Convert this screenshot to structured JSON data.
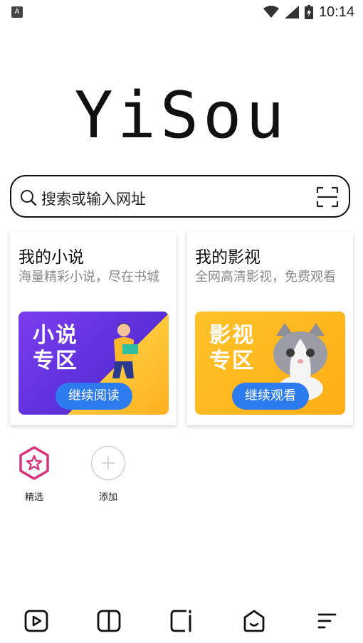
{
  "status_bar": {
    "left_badge": "A",
    "time": "10:14"
  },
  "logo": "YiSou",
  "search": {
    "placeholder": "搜索或输入网址"
  },
  "cards": [
    {
      "title": "我的小说",
      "desc": "海量精彩小说，尽在书城",
      "banner_text_line1": "小说",
      "banner_text_line2": "专区",
      "button": "继续阅读"
    },
    {
      "title": "我的影视",
      "desc": "全网高清影视，免费观看",
      "banner_text_line1": "影视",
      "banner_text_line2": "专区",
      "button": "继续观看"
    }
  ],
  "shortcuts": [
    {
      "label": "精选",
      "icon": "star-hexagon-icon"
    },
    {
      "label": "添加",
      "icon": "plus-icon"
    }
  ],
  "bottom_nav": [
    {
      "icon": "play-icon"
    },
    {
      "icon": "book-icon"
    },
    {
      "icon": "tabs-icon"
    },
    {
      "icon": "home-icon"
    },
    {
      "icon": "menu-icon"
    }
  ],
  "colors": {
    "accent_blue": "#2c7cf0",
    "featured_pink": "#d6337a",
    "novel_purple": "#6a35e6",
    "video_yellow": "#ffb51e"
  }
}
